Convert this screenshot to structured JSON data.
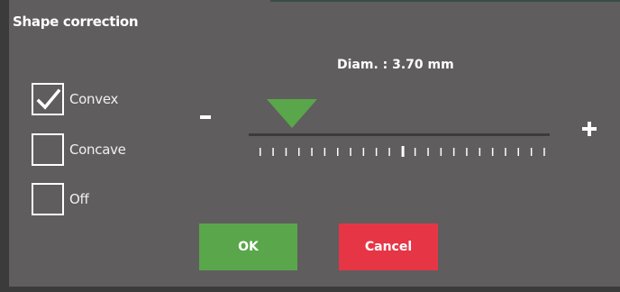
{
  "dialog": {
    "title": "Shape correction"
  },
  "options": [
    {
      "label": "Convex",
      "checked": true
    },
    {
      "label": "Concave",
      "checked": false
    },
    {
      "label": "Off",
      "checked": false
    }
  ],
  "slider": {
    "diameter_label": "Diam. : 3.70 mm",
    "minus_label": "-",
    "plus_label": "+",
    "value_fraction": 0.12,
    "pointer_color": "#5aa64a"
  },
  "buttons": {
    "ok_label": "OK",
    "cancel_label": "Cancel",
    "ok_color": "#5aa64a",
    "cancel_color": "#e63646"
  }
}
